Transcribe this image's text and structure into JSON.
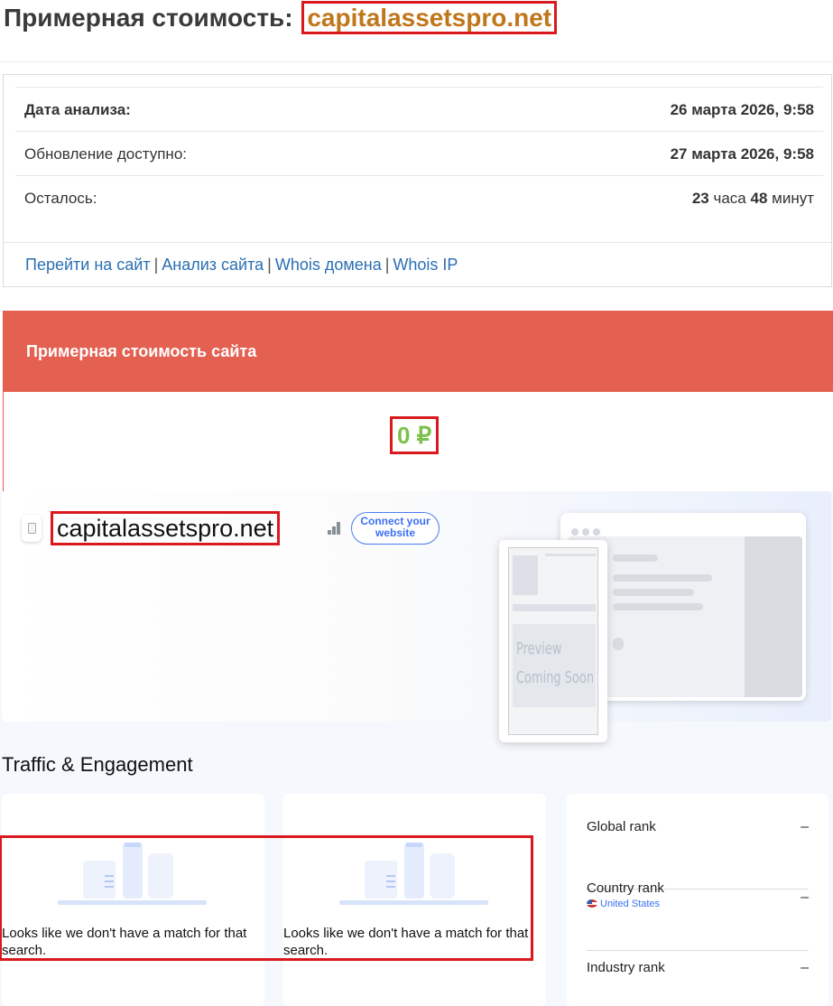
{
  "header": {
    "title_prefix": "Примерная стоимость:",
    "domain": "capitalassetspro.net"
  },
  "info": {
    "analysis_date_label": "Дата анализа:",
    "analysis_date_value": "26 марта 2026, 9:58",
    "update_label": "Обновление доступно:",
    "update_value": "27 марта 2026, 9:58",
    "remaining_label": "Осталось:",
    "remaining_hours": "23",
    "remaining_hours_unit": "часа",
    "remaining_minutes": "48",
    "remaining_minutes_unit": "минут"
  },
  "links": [
    "Перейти на сайт",
    "Анализ сайта",
    "Whois домена",
    "Whois IP"
  ],
  "estimate": {
    "heading": "Примерная стоимость сайта",
    "amount": "0 ₽",
    "amount_color": "#7cc14b",
    "header_color": "#e46050"
  },
  "similarweb": {
    "domain": "capitalassetspro.net",
    "connect_button": "Connect your website",
    "preview_line1": "Preview",
    "preview_line2": "Coming Soon",
    "section_title": "Traffic & Engagement",
    "no_match_text": "Looks like we don't have a match for that search.",
    "ranks": [
      {
        "label": "Global rank",
        "value": "–"
      },
      {
        "label": "Country rank",
        "sub": "United States",
        "value": "–"
      },
      {
        "label": "Industry rank",
        "value": "–"
      }
    ]
  }
}
